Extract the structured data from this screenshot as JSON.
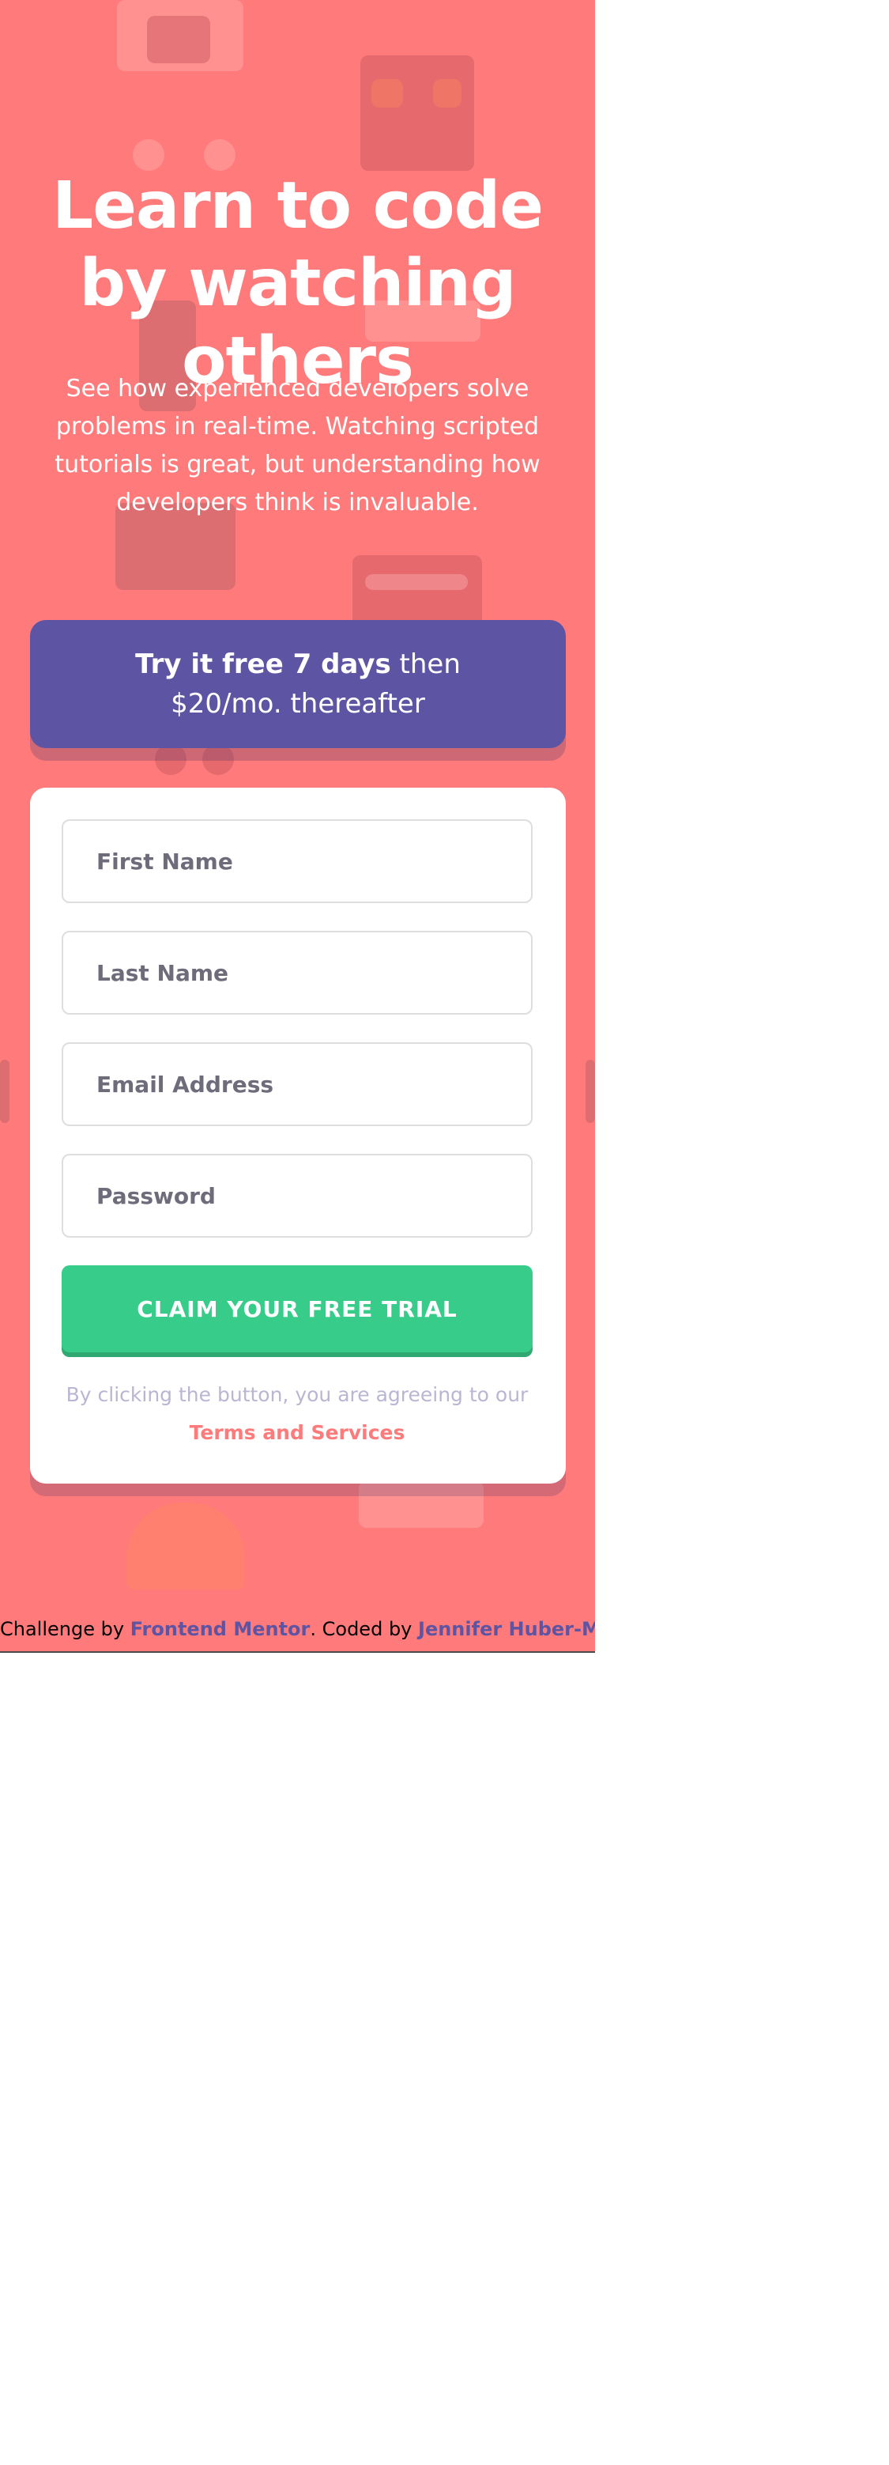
{
  "hero": {
    "title": "Learn to code by watching others",
    "description": "See how experienced developers solve problems in real-time. Watching scripted tutorials is great, but understanding how developers think is invaluable."
  },
  "promo": {
    "bold": "Try it free 7 days",
    "rest": " then $20/mo. thereafter"
  },
  "form": {
    "fields": [
      {
        "placeholder": "First Name"
      },
      {
        "placeholder": "Last Name"
      },
      {
        "placeholder": "Email Address"
      },
      {
        "placeholder": "Password"
      }
    ],
    "submit_label": "CLAIM YOUR FREE TRIAL",
    "terms_text": "By clicking the button, you are agreeing to our ",
    "terms_link": "Terms and Services"
  },
  "footer": {
    "prefix": "Challenge by ",
    "challenge_link": "Frontend Mentor",
    "middle": ". Coded by ",
    "author_link": "Jennifer Huber-Mayer",
    "suffix": "."
  },
  "colors": {
    "background": "#ff7a7a",
    "promo": "#5e54a4",
    "cta": "#38cc8b",
    "terms_link": "#ff7a7a",
    "footer_link": "#5e54a4"
  },
  "icons": {
    "background_pattern": "background-pattern-icon"
  }
}
